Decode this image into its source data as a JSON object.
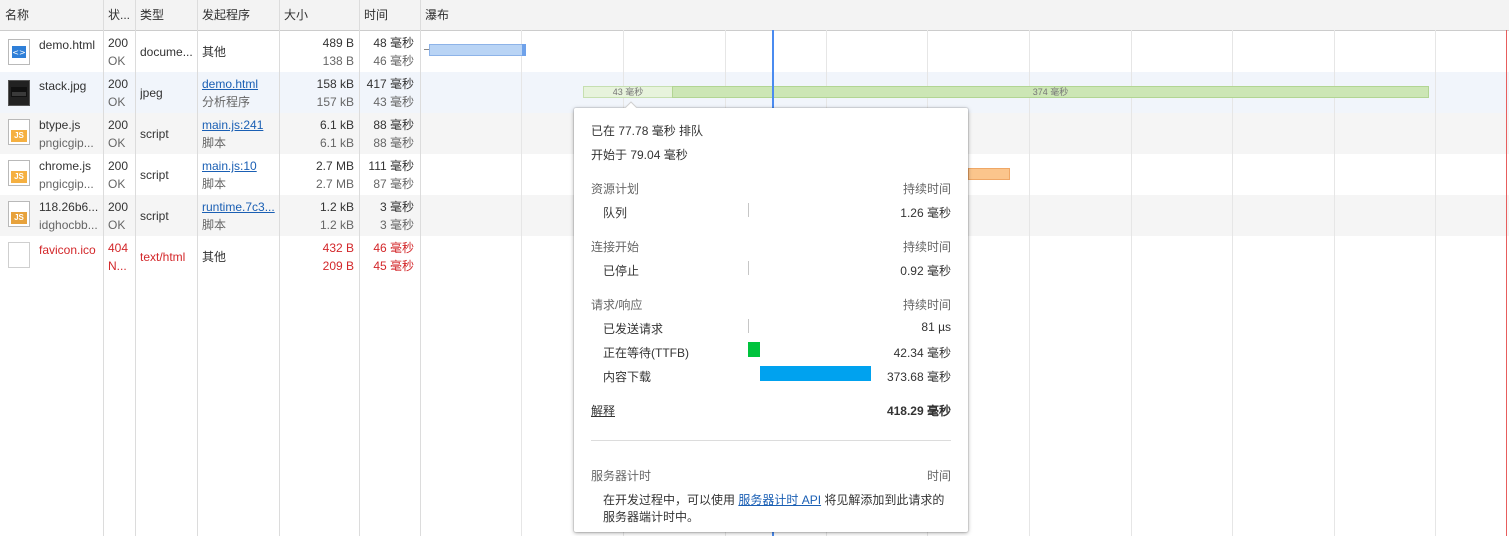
{
  "header": {
    "name": "名称",
    "status": "状...",
    "type": "类型",
    "initiator": "发起程序",
    "size": "大小",
    "time": "时间",
    "waterfall": "瀑布"
  },
  "rows": [
    {
      "name": "demo.html",
      "sub": "",
      "status": "200",
      "status_text": "OK",
      "type": "docume...",
      "initiator": "其他",
      "initiator_sub": "",
      "size": "489 B",
      "size_sub": "138 B",
      "time": "48 毫秒",
      "time_sub": "46 毫秒",
      "icon": "html-file-icon"
    },
    {
      "name": "stack.jpg",
      "sub": "",
      "status": "200",
      "status_text": "OK",
      "type": "jpeg",
      "initiator": "demo.html",
      "initiator_sub": "分析程序",
      "size": "158 kB",
      "size_sub": "157 kB",
      "time": "417 毫秒",
      "time_sub": "43 毫秒",
      "icon": "image-file-icon"
    },
    {
      "name": "btype.js",
      "sub": "pngicgip...",
      "status": "200",
      "status_text": "OK",
      "type": "script",
      "initiator": "main.js:241",
      "initiator_sub": "脚本",
      "size": "6.1 kB",
      "size_sub": "6.1 kB",
      "time": "88 毫秒",
      "time_sub": "88 毫秒",
      "icon": "js-file-icon"
    },
    {
      "name": "chrome.js",
      "sub": "pngicgip...",
      "status": "200",
      "status_text": "OK",
      "type": "script",
      "initiator": "main.js:10",
      "initiator_sub": "脚本",
      "size": "2.7 MB",
      "size_sub": "2.7 MB",
      "time": "111 毫秒",
      "time_sub": "87 毫秒",
      "icon": "js-file-icon"
    },
    {
      "name": "118.26b6...",
      "sub": "idghocbb...",
      "status": "200",
      "status_text": "OK",
      "type": "script",
      "initiator": "runtime.7c3...",
      "initiator_sub": "脚本",
      "size": "1.2 kB",
      "size_sub": "1.2 kB",
      "time": "3 毫秒",
      "time_sub": "3 毫秒",
      "icon": "js-file-icon"
    },
    {
      "name": "favicon.ico",
      "sub": "",
      "status": "404",
      "status_text": "N...",
      "type": "text/html",
      "initiator": "其他",
      "initiator_sub": "",
      "size": "432 B",
      "size_sub": "209 B",
      "time": "46 毫秒",
      "time_sub": "45 毫秒",
      "icon": "blank-file-icon"
    }
  ],
  "waterfall": {
    "stack_bar_waiting": "43 毫秒",
    "stack_bar_download": "374 毫秒"
  },
  "popup": {
    "queued_at": "已在 77.78 毫秒 排队",
    "started_at": "开始于 79.04 毫秒",
    "resource_scheduling": "资源计划",
    "duration_label": "持续时间",
    "queueing": "队列",
    "queueing_value": "1.26 毫秒",
    "connection_start": "连接开始",
    "stalled": "已停止",
    "stalled_value": "0.92 毫秒",
    "request_response": "请求/响应",
    "request_sent": "已发送请求",
    "request_sent_value": "81 µs",
    "waiting": "正在等待(TTFB)",
    "waiting_value": "42.34 毫秒",
    "content_download": "内容下载",
    "content_download_value": "373.68 毫秒",
    "explanation": "解释",
    "total": "418.29 毫秒",
    "server_timing": "服务器计时",
    "time_label": "时间",
    "server_text_pre": "在开发过程中，可以使用",
    "server_link": "服务器计时 API",
    "server_text_post": "将见解添加到此请求的",
    "server_text_line2": "服务器端计时中。"
  },
  "colors": {
    "ttfb": "#00c33d",
    "download": "#00a2ef",
    "error": "#d3272a",
    "link": "#1a5fb4",
    "dom_content_loaded": "#4a8bf0",
    "load": "#e85d5d"
  }
}
